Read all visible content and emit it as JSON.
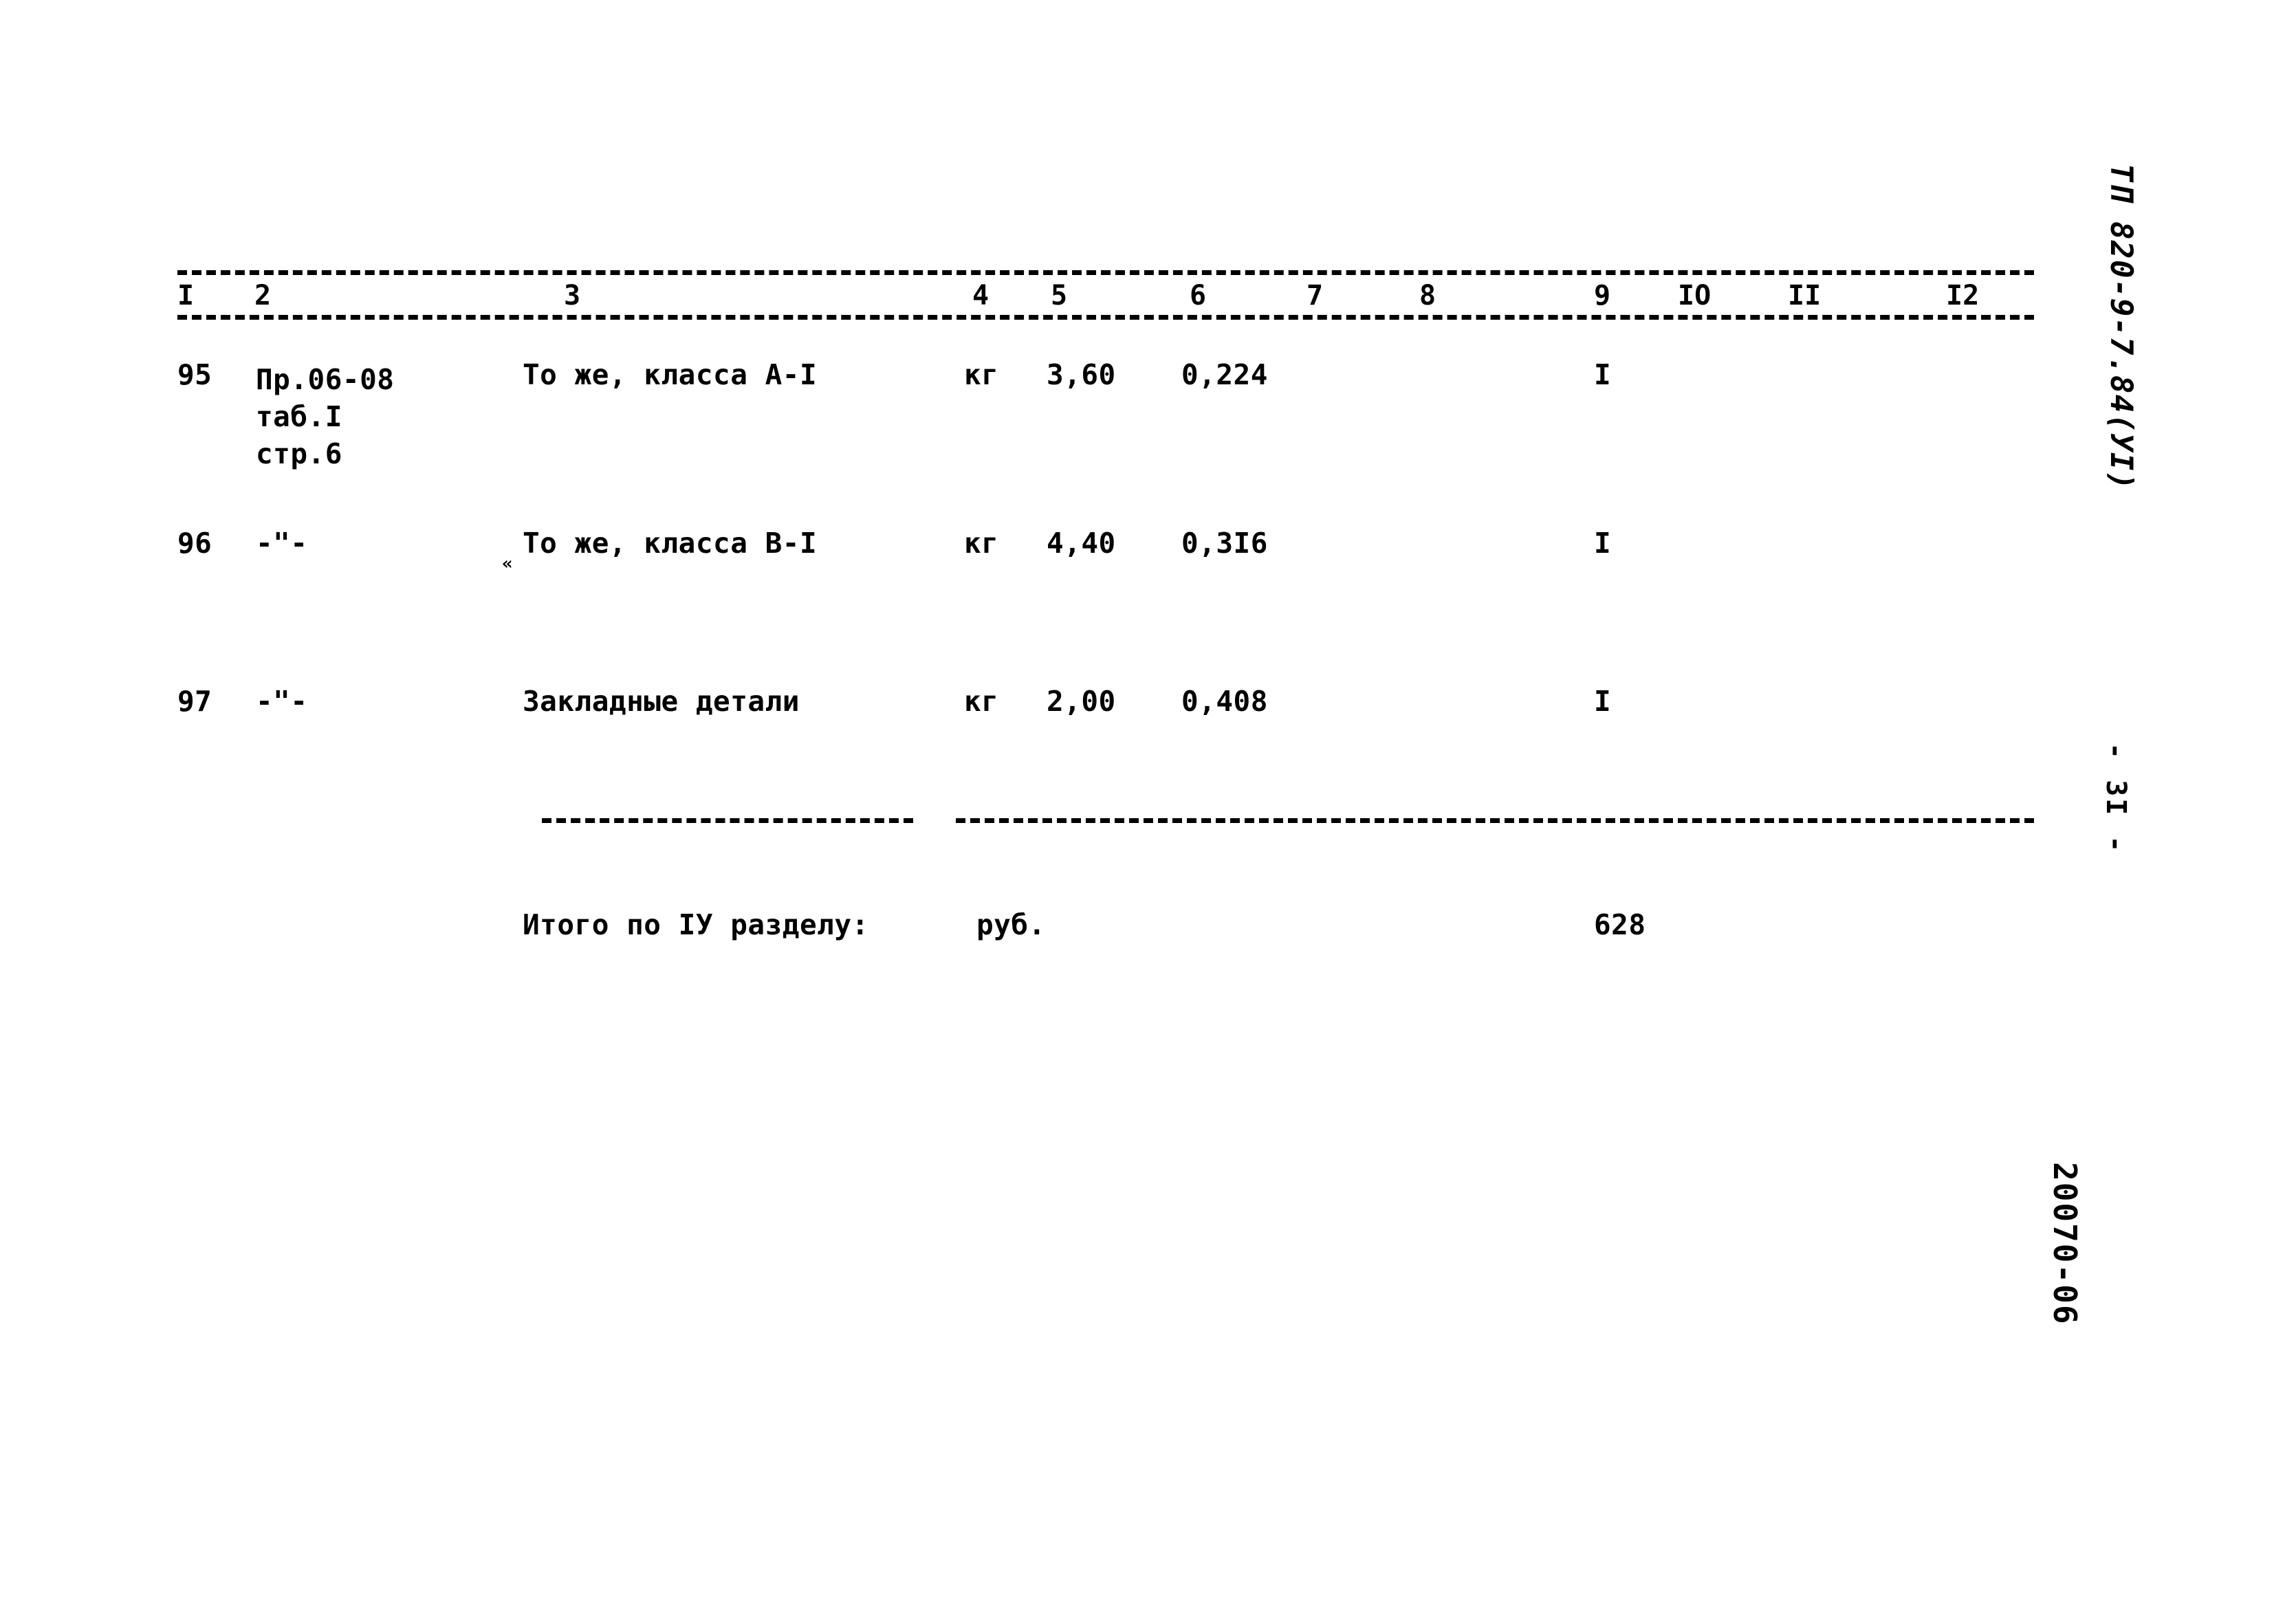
{
  "document": {
    "type": "soviet-technical-estimate-table",
    "margin_marks": {
      "project_code": "ТП 820-9-7.84(УI)",
      "page_number": "- 3I -",
      "archive_number": "20070-06"
    }
  },
  "table": {
    "column_headers": [
      "I",
      "2",
      "3",
      "4",
      "5",
      "6",
      "7",
      "8",
      "9",
      "IO",
      "II",
      "I2"
    ],
    "rows": [
      {
        "col1": "95",
        "col2": "Пр.06-08\nтаб.I\nстр.6",
        "col3": "То же, класса А-I",
        "col4": "кг",
        "col5": "3,60",
        "col6": "0,224",
        "col7": "",
        "col8": "",
        "col9": "I",
        "col10": "",
        "col11": "",
        "col12": ""
      },
      {
        "col1": "96",
        "col2": "-\"-",
        "col3": "То же, класса В-I",
        "col4": "кг",
        "col5": "4,40",
        "col6": "0,3I6",
        "col7": "",
        "col8": "",
        "col9": "I",
        "col10": "",
        "col11": "",
        "col12": ""
      },
      {
        "col1": "97",
        "col2": "-\"-",
        "col3": "Закладные детали",
        "col4": "кг",
        "col5": "2,00",
        "col6": "0,408",
        "col7": "",
        "col8": "",
        "col9": "I",
        "col10": "",
        "col11": "",
        "col12": ""
      }
    ],
    "total_row": {
      "label": "Итого по IУ разделу:",
      "unit": "руб.",
      "value": "628"
    },
    "stray_mark": "«"
  }
}
